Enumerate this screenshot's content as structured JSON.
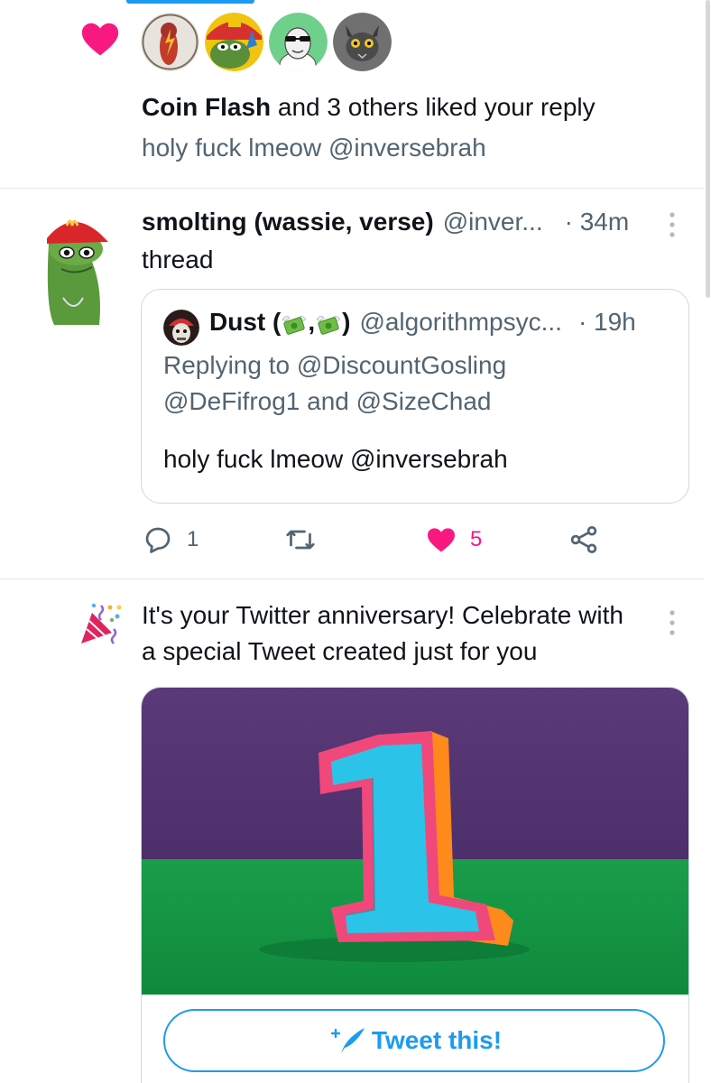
{
  "like_notification": {
    "liker_name": "Coin Flash",
    "summary_rest": " and 3 others liked your reply",
    "reply_text": "holy fuck lmeow @inversebrah",
    "icons": [
      "heart-icon"
    ]
  },
  "tweet": {
    "name": "smolting (wassie, verse)",
    "handle": "@inver...",
    "time": "· 34m",
    "text": "thread",
    "quote": {
      "name_prefix": "Dust (",
      "name_sep": ",",
      "name_suffix": ")",
      "handle": "@algorithmpsyc...",
      "time": "· 19h",
      "replying_line1": "Replying to @DiscountGosling",
      "replying_line2": "@DeFifrog1 and @SizeChad",
      "text": "holy fuck lmeow @inversebrah"
    },
    "actions": {
      "reply_count": "1",
      "retweet_count": "",
      "like_count": "5"
    }
  },
  "anniversary": {
    "line1": "It's your Twitter anniversary! Celebrate with",
    "line2": "a special Tweet created just for you",
    "button_label": "Tweet this!"
  },
  "colors": {
    "accent": "#1d9bf0",
    "like": "#f91880",
    "secondary_text": "#536471",
    "border": "#e5e8ea"
  }
}
